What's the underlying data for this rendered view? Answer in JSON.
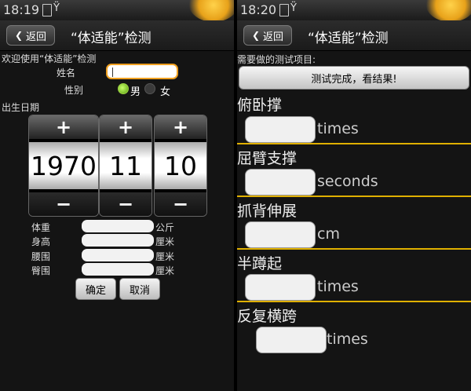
{
  "left": {
    "status": {
      "time": "18:19"
    },
    "titlebar": {
      "back_label": "返回",
      "title": "“体适能”检测"
    },
    "welcome": "欢迎使用“体适能”检测",
    "name_label": "姓名",
    "gender_label": "性别",
    "gender_options": [
      "男",
      "女"
    ],
    "gender_selected": "男",
    "birth_label": "出生日期",
    "birth": {
      "year": "1970",
      "month": "11",
      "day": "10",
      "plus": "+",
      "minus": "−"
    },
    "measurements": [
      {
        "label": "体重",
        "unit": "公斤"
      },
      {
        "label": "身高",
        "unit": "厘米"
      },
      {
        "label": "腰围",
        "unit": "厘米"
      },
      {
        "label": "臀围",
        "unit": "厘米"
      }
    ],
    "buttons": {
      "confirm": "确定",
      "cancel": "取消"
    }
  },
  "right": {
    "status": {
      "time": "18:20"
    },
    "titlebar": {
      "back_label": "返回",
      "title": "“体适能”检测"
    },
    "section_label": "需要做的测试项目:",
    "result_button": "测试完成，看结果!",
    "tests": [
      {
        "name": "俯卧撑",
        "unit": "times"
      },
      {
        "name": "屈臂支撑",
        "unit": "seconds"
      },
      {
        "name": "抓背伸展",
        "unit": "cm"
      },
      {
        "name": "半蹲起",
        "unit": "times"
      },
      {
        "name": "反复横跨",
        "unit": "times"
      }
    ]
  },
  "colors": {
    "accent": "#f0a020",
    "separator": "#e0b000",
    "radio_on": "#7fc020"
  }
}
